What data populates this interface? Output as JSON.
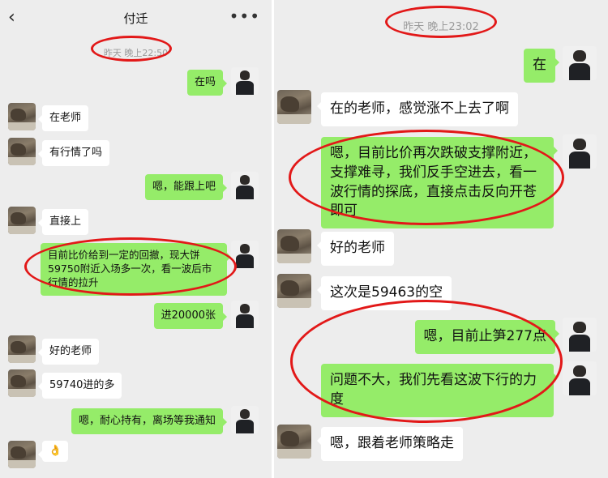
{
  "left_screen": {
    "header": {
      "back_icon": "chevron-left-icon",
      "title": "付迁",
      "more_icon": "more-dots-icon"
    },
    "timestamp": "昨天 晚上22:50",
    "messages": [
      {
        "from": "self",
        "text": "在吗"
      },
      {
        "from": "other",
        "text": "在老师"
      },
      {
        "from": "other",
        "text": "有行情了吗"
      },
      {
        "from": "self",
        "text": "嗯，能跟上吧"
      },
      {
        "from": "other",
        "text": "直接上"
      },
      {
        "from": "self",
        "text": "目前比价给到一定的回撤，现大饼59750附近入场多一次，看一波后市行情的拉升"
      },
      {
        "from": "self",
        "text": "进20000张"
      },
      {
        "from": "other",
        "text": "好的老师"
      },
      {
        "from": "other",
        "text": "59740进的多"
      },
      {
        "from": "self",
        "text": "嗯，耐心持有，离场等我通知"
      },
      {
        "from": "other",
        "text": "👌"
      }
    ]
  },
  "right_screen": {
    "timestamp": "昨天 晚上23:02",
    "messages": [
      {
        "from": "self",
        "text": "在"
      },
      {
        "from": "other",
        "text": "在的老师，感觉涨不上去了啊"
      },
      {
        "from": "self",
        "text": "嗯，目前比价再次跌破支撑附近，支撑难寻，我们反手空进去，看一波行情的探底，直接点击反向开苍即可"
      },
      {
        "from": "other",
        "text": "好的老师"
      },
      {
        "from": "other",
        "text": "这次是59463的空"
      },
      {
        "from": "self",
        "text": "嗯，目前止笋277点"
      },
      {
        "from": "self",
        "text": "问题不大，我们先看这波下行的力度"
      },
      {
        "from": "other",
        "text": "嗯，跟着老师策略走"
      }
    ]
  },
  "colors": {
    "out_bubble": "#95ec69",
    "in_bubble": "#ffffff",
    "background": "#ededed",
    "annotation_ring": "#e21818",
    "timestamp": "#9b9b9b"
  }
}
